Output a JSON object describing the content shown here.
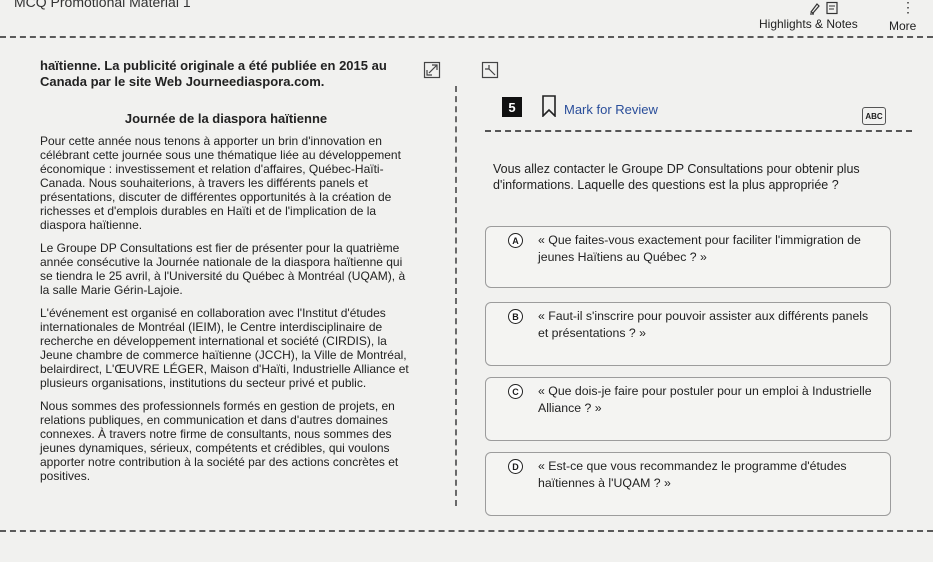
{
  "header": {
    "title": "MCQ Promotional Material 1",
    "highlights_label": "Highlights & Notes",
    "more_label": "More"
  },
  "passage": {
    "intro": "haïtienne. La publicité originale a été publiée en 2015 au Canada par le site Web Journeediaspora.com.",
    "heading": "Journée de la diaspora haïtienne",
    "paragraphs": [
      "Pour cette année nous tenons à apporter un brin d'innovation en célébrant cette journée sous une thématique liée au développement économique : investissement et relation d'affaires, Québec-Haïti-Canada. Nous souhaiterions, à travers les différents panels et présentations, discuter de différentes opportunités à la création de richesses et d'emplois durables en Haïti et de l'implication de la diaspora haïtienne.",
      "Le Groupe DP Consultations est fier de présenter pour la quatrième année consécutive la Journée nationale de la diaspora haïtienne qui se tiendra le 25 avril, à l'Université du Québec à Montréal (UQAM), à la salle Marie Gérin-Lajoie.",
      "L'événement est organisé en collaboration avec l'Institut d'études internationales de Montréal (IEIM), le Centre interdisciplinaire de recherche en développement international et société (CIRDIS), la Jeune chambre de commerce haïtienne (JCCH), la Ville de Montréal, belairdirect, L'ŒUVRE LÉGER, Maison d'Haïti, Industrielle Alliance et plusieurs organisations, institutions du secteur privé et public.",
      "Nous sommes des professionnels formés en gestion de projets, en relations publiques, en communication et dans d'autres domaines connexes. À travers notre firme de consultants, nous sommes des jeunes dynamiques, sérieux, compétents et crédibles, qui voulons apporter notre contribution à la société par des actions concrètes et positives."
    ]
  },
  "question": {
    "number": "5",
    "mark_label": "Mark for Review",
    "abc_label": "ABC",
    "prompt": "Vous allez contacter le Groupe DP Consultations pour obtenir plus d'informations. Laquelle des questions est la plus appropriée ?",
    "options": [
      {
        "letter": "A",
        "text": "« Que faites-vous exactement pour faciliter l'immigration de jeunes Haïtiens au Québec ? »"
      },
      {
        "letter": "B",
        "text": "« Faut-il s'inscrire pour pouvoir assister aux différents panels et présentations ? »"
      },
      {
        "letter": "C",
        "text": "« Que dois-je faire pour postuler pour un emploi à Industrielle Alliance ? »"
      },
      {
        "letter": "D",
        "text": "« Est-ce que vous recommandez le programme d'études haïtiennes à l'UQAM ? »"
      }
    ]
  },
  "icons": {
    "highlight": "highlighter-icon",
    "notes": "notes-icon",
    "more": "more-vertical-icon",
    "expand": "expand-icon",
    "collapse": "collapse-icon",
    "bookmark": "bookmark-icon"
  },
  "colors": {
    "accent": "#2a4e9a",
    "background": "#f1f1ef"
  }
}
